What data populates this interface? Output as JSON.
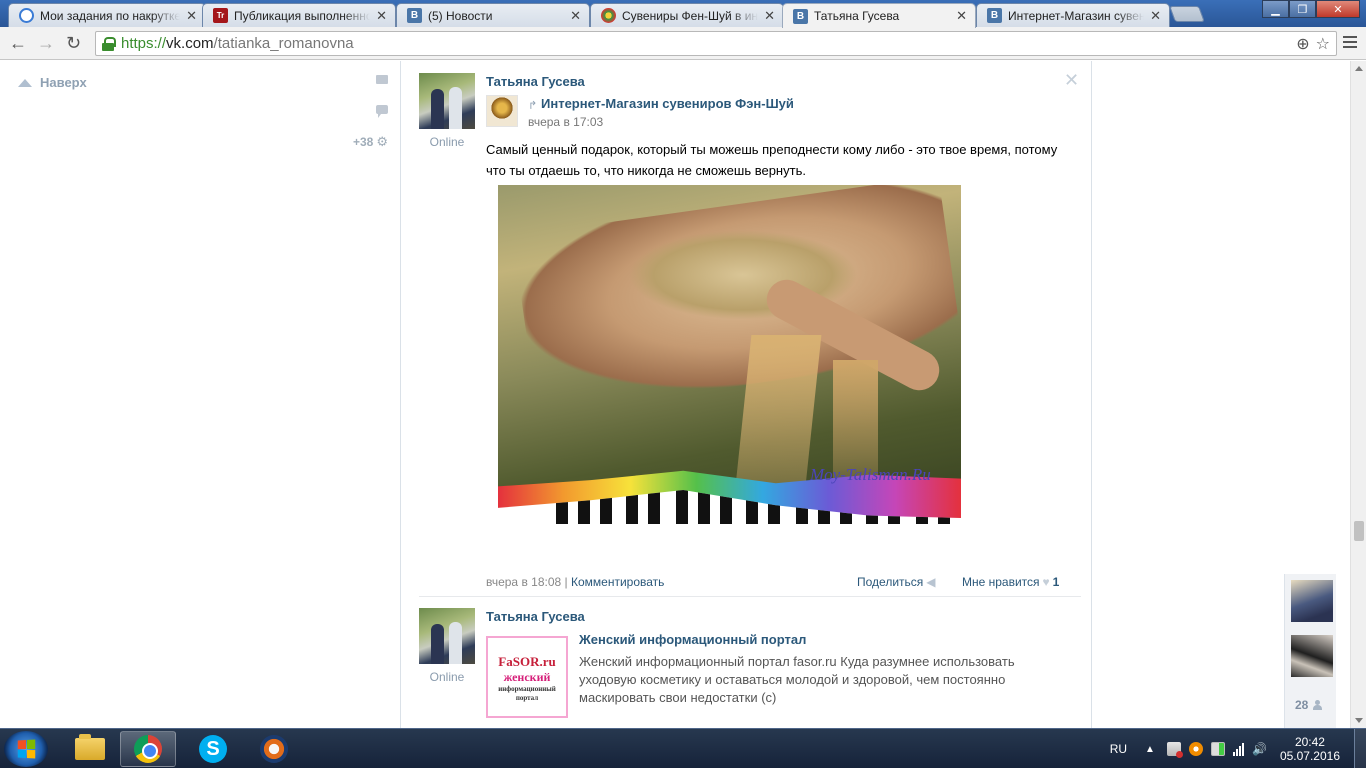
{
  "browser": {
    "tabs": [
      {
        "title": "Мои задания по накрутке",
        "favicon": "ring-icon",
        "active": false
      },
      {
        "title": "Публикация выполненного",
        "favicon": "tr-icon",
        "active": false
      },
      {
        "title": "(5) Новости",
        "favicon": "vk-icon",
        "active": false
      },
      {
        "title": "Сувениры Фен-Шуй в интернет",
        "favicon": "fengshui-icon",
        "active": false
      },
      {
        "title": "Татьяна Гусева",
        "favicon": "vk-icon",
        "active": true
      },
      {
        "title": "Интернет-Магазин сувениров",
        "favicon": "vk-icon",
        "active": false
      }
    ],
    "url_scheme": "https://",
    "url_host": "vk.com",
    "url_path": "/tatianka_romanovna"
  },
  "sidebar": {
    "up_label": "Наверх",
    "counter": "+38"
  },
  "posts": [
    {
      "author": "Татьяна Гусева",
      "status": "Online",
      "repost_source": "Интернет-Магазин сувениров Фэн-Шуй",
      "repost_time": "вчера в 17:03",
      "text": "Самый ценный подарок, который ты можешь преподнести кому либо - это твое время, потому что ты отдаешь то, что никогда не сможешь вернуть.",
      "image_watermark": "Moy-Talisman.Ru",
      "time": "вчера в 18:08",
      "comment_label": "Комментировать",
      "share_label": "Поделиться",
      "like_label": "Мне нравится",
      "like_count": "1"
    },
    {
      "author": "Татьяна Гусева",
      "status": "Online",
      "link_thumb_line1": "FaSOR.ru",
      "link_thumb_line2": "женский",
      "link_thumb_line3": "информационный портал",
      "link_title": "Женский информационный портал",
      "link_description": "Женский информационный портал fasor.ru Куда разумнее использовать уходовую косметику и оставаться молодой и здоровой, чем постоянно маскировать свои недостатки (с)"
    }
  ],
  "friends_widget": {
    "count": "28"
  },
  "taskbar": {
    "language": "RU",
    "time": "20:42",
    "date": "05.07.2016"
  },
  "colors": {
    "link": "#2b587a",
    "vk_blue": "#4a76a8",
    "muted": "#8a9bad"
  }
}
